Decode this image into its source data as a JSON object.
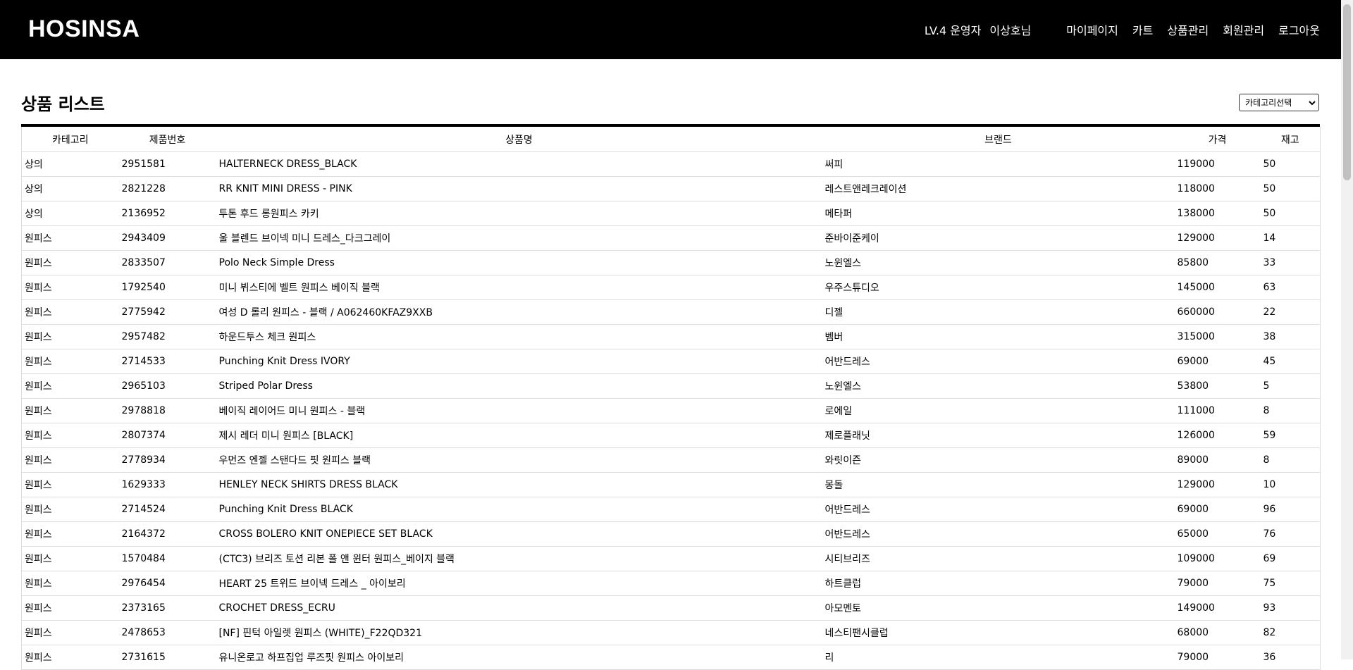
{
  "header": {
    "logo": "HOSINSA",
    "user_level": "LV.4 운영자",
    "user_name": "이상호님",
    "nav": [
      "마이페이지",
      "카트",
      "상품관리",
      "회원관리",
      "로그아웃"
    ]
  },
  "main": {
    "title": "상품 리스트",
    "category_select": "카테고리선택",
    "columns": [
      "카테고리",
      "제품번호",
      "상품명",
      "브랜드",
      "가격",
      "재고"
    ],
    "rows": [
      [
        "상의",
        "2951581",
        "HALTERNECK DRESS_BLACK",
        "써피",
        "119000",
        "50"
      ],
      [
        "상의",
        "2821228",
        "RR KNIT MINI DRESS - PINK",
        "레스트앤레크레이션",
        "118000",
        "50"
      ],
      [
        "상의",
        "2136952",
        "투톤 후드 롱원피스 카키",
        "메타퍼",
        "138000",
        "50"
      ],
      [
        "원피스",
        "2943409",
        "울 블렌드 브이넥 미니 드레스_다크그레이",
        "준바이준케이",
        "129000",
        "14"
      ],
      [
        "원피스",
        "2833507",
        "Polo Neck Simple Dress",
        "노윈엘스",
        "85800",
        "33"
      ],
      [
        "원피스",
        "1792540",
        "미니 뷔스티에 벨트 원피스 베이직 블랙",
        "우주스튜디오",
        "145000",
        "63"
      ],
      [
        "원피스",
        "2775942",
        "여성 D 롤리 원피스 - 블랙 / A062460KFAZ9XXB",
        "디젤",
        "660000",
        "22"
      ],
      [
        "원피스",
        "2957482",
        "하운드투스 체크 원피스",
        "벰버",
        "315000",
        "38"
      ],
      [
        "원피스",
        "2714533",
        "Punching Knit Dress IVORY",
        "어반드레스",
        "69000",
        "45"
      ],
      [
        "원피스",
        "2965103",
        "Striped Polar Dress",
        "노윈엘스",
        "53800",
        "5"
      ],
      [
        "원피스",
        "2978818",
        "베이직 레이어드 미니 원피스 - 블랙",
        "로에일",
        "111000",
        "8"
      ],
      [
        "원피스",
        "2807374",
        "제시 레더 미니 원피스 [BLACK]",
        "제로플래닛",
        "126000",
        "59"
      ],
      [
        "원피스",
        "2778934",
        "우먼즈 엔젤 스탠다드 핏 원피스 블랙",
        "와릿이즌",
        "89000",
        "8"
      ],
      [
        "원피스",
        "1629333",
        "HENLEY NECK SHIRTS DRESS BLACK",
        "몽돌",
        "129000",
        "10"
      ],
      [
        "원피스",
        "2714524",
        "Punching Knit Dress BLACK",
        "어반드레스",
        "69000",
        "96"
      ],
      [
        "원피스",
        "2164372",
        "CROSS BOLERO KNIT ONEPIECE SET BLACK",
        "어반드레스",
        "65000",
        "76"
      ],
      [
        "원피스",
        "1570484",
        "(CTC3) 브리즈 토션 리본 폴 앤 윈터 원피스_베이지 블랙",
        "시티브리즈",
        "109000",
        "69"
      ],
      [
        "원피스",
        "2976454",
        "HEART 25 트위드 브이넥 드레스 _ 아이보리",
        "하트클럽",
        "79000",
        "75"
      ],
      [
        "원피스",
        "2373165",
        "CROCHET DRESS_ECRU",
        "아모멘토",
        "149000",
        "93"
      ],
      [
        "원피스",
        "2478653",
        "[NF] 핀턱 아일렛 원피스 (WHITE)_F22QD321",
        "네스티팬시클럽",
        "68000",
        "82"
      ],
      [
        "원피스",
        "2731615",
        "유니온로고 하프집업 루즈핏 원피스 아이보리",
        "리",
        "79000",
        "36"
      ]
    ]
  }
}
